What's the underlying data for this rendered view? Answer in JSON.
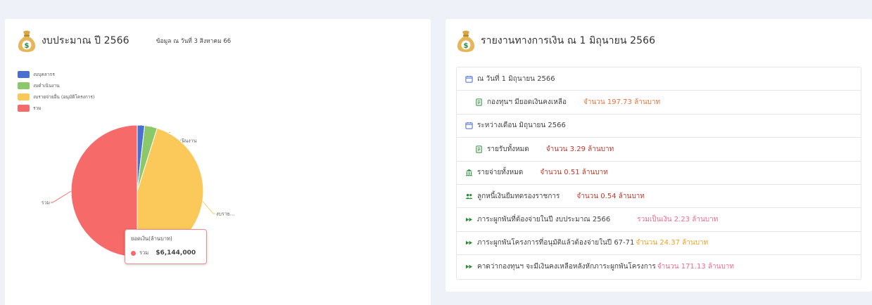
{
  "budget_card": {
    "title": "งบประมาณ ปี 2566",
    "note": "ข้อมูล ณ วันที่ 3 สิงหาคม 66",
    "icon": "money-bag-icon"
  },
  "finance_card": {
    "title": "รายงานทางการเงิน ณ 1 มิถุนายน 2566",
    "icon": "money-bag-icon",
    "rows": [
      {
        "icon": "calendar-icon",
        "label": "ณ วันที่ 1 มิถุนายน 2566",
        "value": "",
        "value_color": "#444444",
        "indent": false
      },
      {
        "icon": "document-icon",
        "label": "กองทุนฯ มียอดเงินคงเหลือ",
        "value": "จำนวน 197.73 ล้านบาท",
        "value_color": "#f0703a",
        "indent": true
      },
      {
        "icon": "calendar-icon",
        "label": "ระหว่างเดือน มิถุนายน 2566",
        "value": "",
        "value_color": "#444444",
        "indent": false
      },
      {
        "icon": "document-icon",
        "label": "รายรับทั้งหมด",
        "value": "จำนวน 3.29 ล้านบาท",
        "value_color": "#c0392b",
        "indent": true
      },
      {
        "icon": "bank-icon",
        "label": "รายจ่ายทั้งหมด",
        "value": "จำนวน 0.51 ล้านบาท",
        "value_color": "#c0392b",
        "indent": false
      },
      {
        "icon": "users-icon",
        "label": "ลูกหนี้เงินยืมทดรองราชการ",
        "value": "จำนวน 0.54 ล้านบาท",
        "value_color": "#c0392b",
        "indent": false
      },
      {
        "icon": "fast-forward-icon",
        "label": "ภาระผูกพันที่ต้องจ่ายในปี งบประมาณ 2566",
        "value": "รวมเป็นเงิน 2.23 ล้านบาท",
        "value_color": "#f06a8a",
        "indent": false
      },
      {
        "icon": "fast-forward-icon",
        "label": "ภาระผูกพันโครงการที่อนุมัติแล้วต้องจ่ายในปี 67-71",
        "value": "จำนวน 24.37 ล้านบาท",
        "value_color": "#f0a020",
        "indent": false
      },
      {
        "icon": "fast-forward-icon",
        "label": "คาดว่ากองทุนฯ จะมีเงินคงเหลือหลังหักภาระผูกพันโครงการ",
        "value": "จำนวน 171.13 ล้านบาท",
        "value_color": "#f06a8a",
        "indent": false
      }
    ]
  },
  "chart_data": {
    "type": "pie",
    "title": "งบประมาณ ปี 2566",
    "legend_position": "top-left",
    "series": [
      {
        "name": "งบบุคลากร",
        "value": 110000,
        "color": "#4a6fd1"
      },
      {
        "name": "งบดำเนินงาน",
        "value": 190000,
        "color": "#8bc86a"
      },
      {
        "name": "งบรายจ่ายอื่น (อนุมัติโครงการ)",
        "value": 2772000,
        "color": "#fbc95a"
      },
      {
        "name": "รวม",
        "value": 3072000,
        "color": "#f76a6a"
      }
    ],
    "slice_labels": [
      "งบบุคลากร",
      "งบดำเนินงาน",
      "งบราย...",
      "รวม"
    ],
    "tooltip": {
      "title": "ยอดเงิน(ล้านบาท)",
      "series_name": "รวม",
      "value": "$6,144,000",
      "color": "#f76a6a"
    }
  }
}
